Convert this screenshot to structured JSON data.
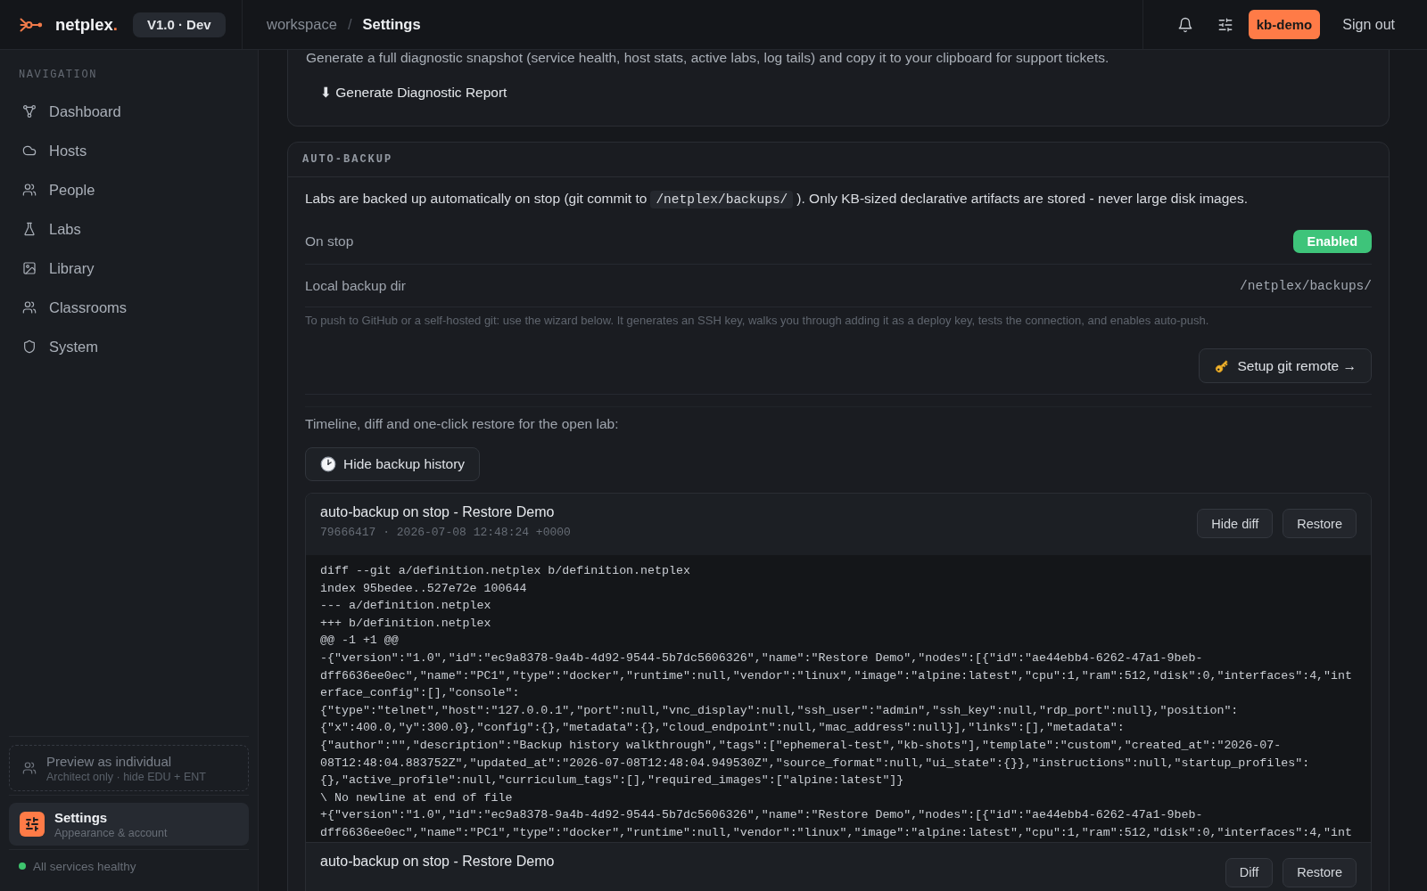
{
  "header": {
    "brand": "netplex",
    "brand_suffix": ".",
    "version": "V1.0 · Dev",
    "breadcrumb": {
      "items": [
        "workspace",
        "Settings"
      ],
      "separator": "/"
    },
    "user": "kb-demo",
    "sign_out": "Sign out"
  },
  "sidebar": {
    "section_label": "NAVIGATION",
    "items": [
      {
        "label": "Dashboard",
        "selected": false
      },
      {
        "label": "Hosts",
        "selected": false
      },
      {
        "label": "People",
        "selected": false
      },
      {
        "label": "Labs",
        "selected": false
      },
      {
        "label": "Library",
        "selected": false
      },
      {
        "label": "Classrooms",
        "selected": false
      },
      {
        "label": "System",
        "selected": false
      }
    ],
    "preview": {
      "title": "Preview as individual",
      "subtitle": "Architect only · hide EDU + ENT"
    },
    "settings_link": {
      "title": "Settings",
      "subtitle": "Appearance & account",
      "selected": true
    },
    "status": {
      "text": "All services healthy",
      "healthy": true
    }
  },
  "diagnostics": {
    "description": "Generate a full diagnostic snapshot (service health, host stats, active labs, log tails) and copy it to your clipboard for support tickets.",
    "button": "⬇ Generate Diagnostic Report"
  },
  "auto_backup": {
    "title": "AUTO-BACKUP",
    "intro": {
      "before": "Labs are backed up automatically on stop (git commit to",
      "code": "/netplex/backups/",
      "after": "). Only KB-sized declarative artifacts are stored - never large disk images."
    },
    "rows": [
      {
        "label": "On stop",
        "kind": "badge",
        "value": "Enabled",
        "on": true
      },
      {
        "label": "Local backup dir",
        "kind": "path",
        "value": "/netplex/backups/"
      }
    ],
    "remote_hint": "To push to GitHub or a self-hosted git: use the wizard below. It generates an SSH key, walks you through adding it as a deploy key, tests the connection, and enables auto-push.",
    "remote_button": "Setup git remote →",
    "history": {
      "intro": "Timeline, diff and one-click restore for the open lab:",
      "toggle": "Hide backup history",
      "entries": [
        {
          "title": "auto-backup on stop - Restore Demo",
          "meta": "79666417 · 2026-07-08 12:48:24 +0000",
          "expanded": true,
          "diff_button": "Hide diff",
          "restore_button": "Restore",
          "diff_lines": [
            "diff --git a/definition.netplex b/definition.netplex",
            "index 95bedee..527e72e 100644",
            "--- a/definition.netplex",
            "+++ b/definition.netplex",
            "@@ -1 +1 @@",
            "-{\"version\":\"1.0\",\"id\":\"ec9a8378-9a4b-4d92-9544-5b7dc5606326\",\"name\":\"Restore Demo\",\"nodes\":[{\"id\":\"ae44ebb4-6262-47a1-9beb-",
            "dff6636ee0ec\",\"name\":\"PC1\",\"type\":\"docker\",\"runtime\":null,\"vendor\":\"linux\",\"image\":\"alpine:latest\",\"cpu\":1,\"ram\":512,\"disk\":0,\"interfaces\":4,\"int",
            "erface_config\":[],\"console\":",
            "{\"type\":\"telnet\",\"host\":\"127.0.0.1\",\"port\":null,\"vnc_display\":null,\"ssh_user\":\"admin\",\"ssh_key\":null,\"rdp_port\":null},\"position\":",
            "{\"x\":400.0,\"y\":300.0},\"config\":{},\"metadata\":{},\"cloud_endpoint\":null,\"mac_address\":null}],\"links\":[],\"metadata\":",
            "{\"author\":\"\",\"description\":\"Backup history walkthrough\",\"tags\":[\"ephemeral-test\",\"kb-shots\"],\"template\":\"custom\",\"created_at\":\"2026-07-",
            "08T12:48:04.883752Z\",\"updated_at\":\"2026-07-08T12:48:04.949530Z\",\"source_format\":null,\"ui_state\":{}},\"instructions\":null,\"startup_profiles\":",
            "{},\"active_profile\":null,\"curriculum_tags\":[],\"required_images\":[\"alpine:latest\"]}",
            "\\ No newline at end of file",
            "+{\"version\":\"1.0\",\"id\":\"ec9a8378-9a4b-4d92-9544-5b7dc5606326\",\"name\":\"Restore Demo\",\"nodes\":[{\"id\":\"ae44ebb4-6262-47a1-9beb-",
            "dff6636ee0ec\",\"name\":\"PC1\",\"type\":\"docker\",\"runtime\":null,\"vendor\":\"linux\",\"image\":\"alpine:latest\",\"cpu\":1,\"ram\":512,\"disk\":0,\"interfaces\":4,\"int"
          ]
        },
        {
          "title": "auto-backup on stop - Restore Demo",
          "expanded": false,
          "diff_button": "Diff",
          "restore_button": "Restore"
        }
      ]
    }
  }
}
